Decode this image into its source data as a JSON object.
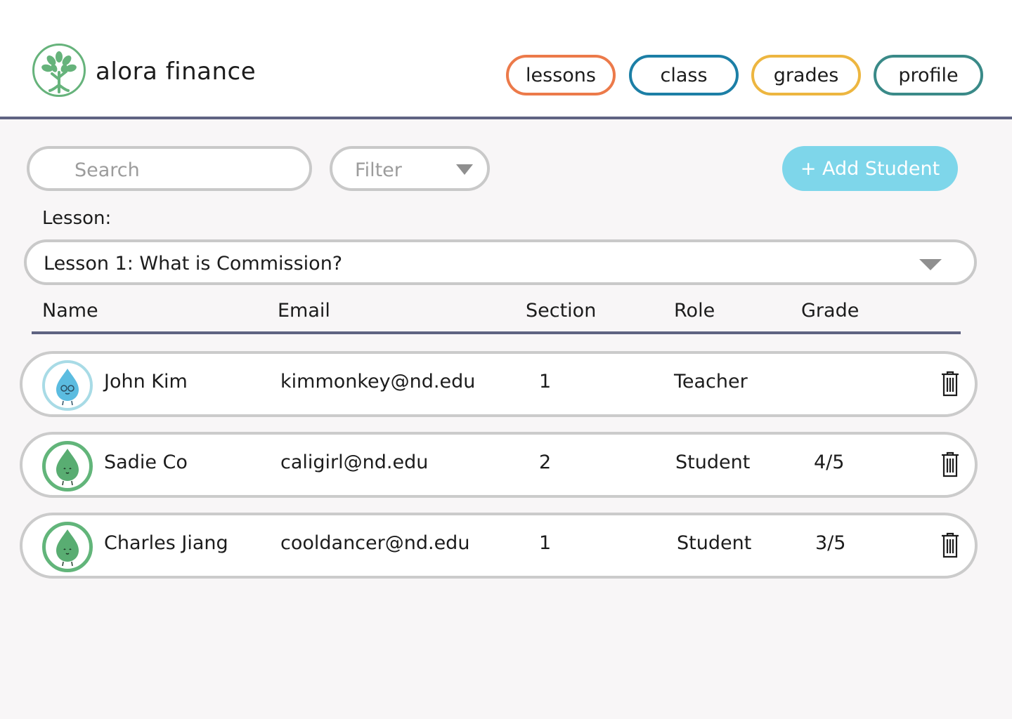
{
  "header": {
    "brand": "alora finance",
    "nav": [
      {
        "label": "lessons",
        "color": "#ec7a4a"
      },
      {
        "label": "class",
        "color": "#1c7fa6"
      },
      {
        "label": "grades",
        "color": "#edb640"
      },
      {
        "label": "profile",
        "color": "#3a8a88"
      }
    ]
  },
  "toolbar": {
    "search_placeholder": "Search",
    "filter_label": "Filter",
    "add_label": "+ Add Student"
  },
  "lesson": {
    "label": "Lesson:",
    "selected": "Lesson 1: What is Commission?"
  },
  "table": {
    "columns": [
      "Name",
      "Email",
      "Section",
      "Role",
      "Grade"
    ],
    "rows": [
      {
        "name": "John Kim",
        "email": "kimmonkey@nd.edu",
        "section": "1",
        "role": "Teacher",
        "grade": "",
        "avatar": "blue-droplet"
      },
      {
        "name": "Sadie Co",
        "email": "caligirl@nd.edu",
        "section": "2",
        "role": "Student",
        "grade": "4/5",
        "avatar": "green-droplet"
      },
      {
        "name": "Charles Jiang",
        "email": "cooldancer@nd.edu",
        "section": "1",
        "role": "Student",
        "grade": "3/5",
        "avatar": "green-droplet"
      }
    ]
  },
  "colors": {
    "accent_rule": "#5f6382",
    "add_button": "#7ed6ea",
    "logo_green": "#66b37b"
  }
}
